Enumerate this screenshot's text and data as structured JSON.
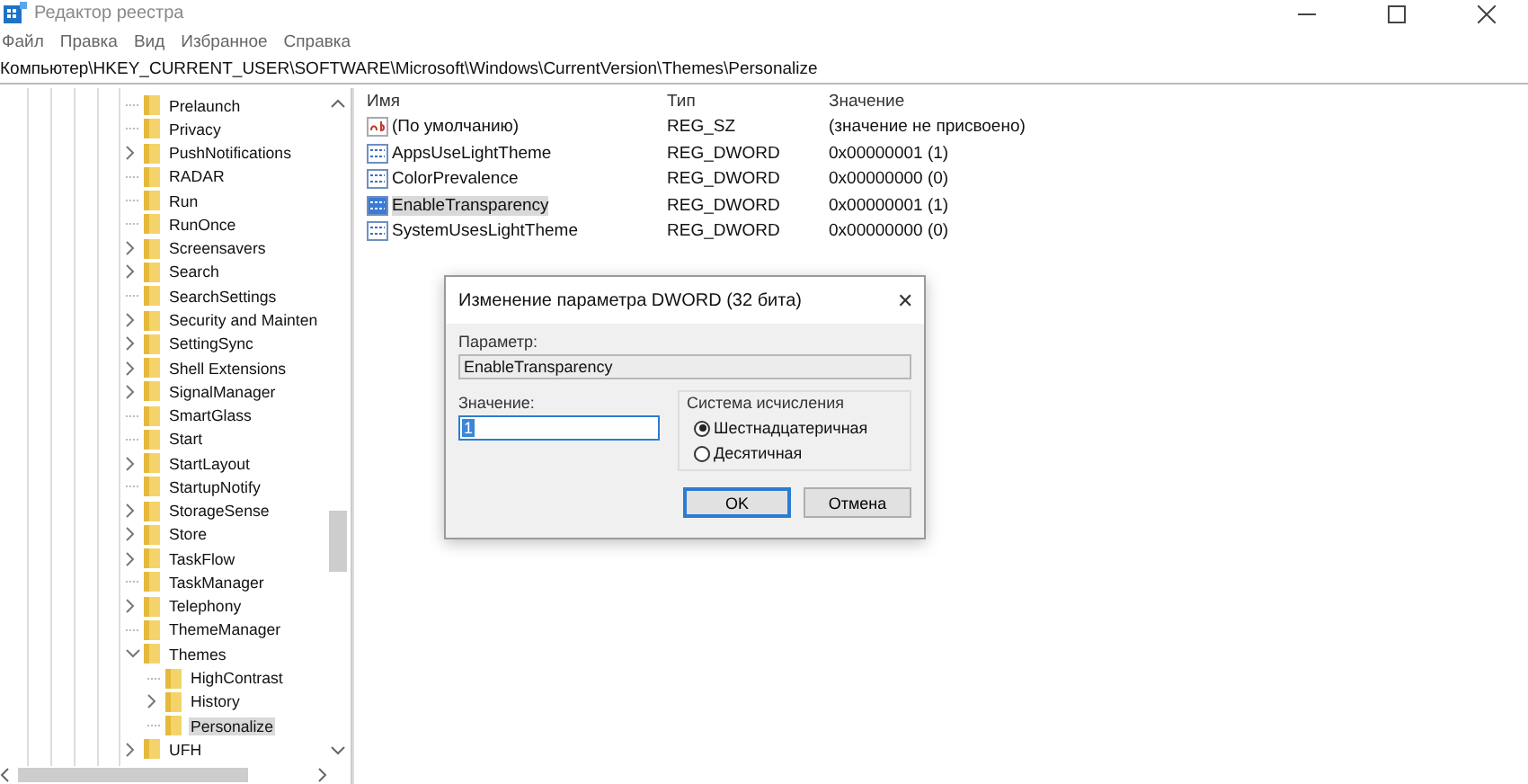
{
  "window": {
    "title": "Редактор реестра"
  },
  "menu": [
    "Файл",
    "Правка",
    "Вид",
    "Избранное",
    "Справка"
  ],
  "address": "Компьютер\\HKEY_CURRENT_USER\\SOFTWARE\\Microsoft\\Windows\\CurrentVersion\\Themes\\Personalize",
  "tree": [
    {
      "label": "Prelaunch",
      "kind": "leaf",
      "selected": false
    },
    {
      "label": "Privacy",
      "kind": "leaf",
      "selected": false
    },
    {
      "label": "PushNotifications",
      "kind": "collapsed",
      "selected": false
    },
    {
      "label": "RADAR",
      "kind": "leaf",
      "selected": false
    },
    {
      "label": "Run",
      "kind": "leaf",
      "selected": false
    },
    {
      "label": "RunOnce",
      "kind": "leaf",
      "selected": false
    },
    {
      "label": "Screensavers",
      "kind": "collapsed",
      "selected": false
    },
    {
      "label": "Search",
      "kind": "collapsed",
      "selected": false
    },
    {
      "label": "SearchSettings",
      "kind": "leaf",
      "selected": false
    },
    {
      "label": "Security and Mainten",
      "kind": "collapsed",
      "selected": false
    },
    {
      "label": "SettingSync",
      "kind": "collapsed",
      "selected": false
    },
    {
      "label": "Shell Extensions",
      "kind": "collapsed",
      "selected": false
    },
    {
      "label": "SignalManager",
      "kind": "collapsed",
      "selected": false
    },
    {
      "label": "SmartGlass",
      "kind": "leaf",
      "selected": false
    },
    {
      "label": "Start",
      "kind": "leaf",
      "selected": false
    },
    {
      "label": "StartLayout",
      "kind": "collapsed",
      "selected": false
    },
    {
      "label": "StartupNotify",
      "kind": "leaf",
      "selected": false
    },
    {
      "label": "StorageSense",
      "kind": "collapsed",
      "selected": false
    },
    {
      "label": "Store",
      "kind": "collapsed",
      "selected": false
    },
    {
      "label": "TaskFlow",
      "kind": "collapsed",
      "selected": false
    },
    {
      "label": "TaskManager",
      "kind": "leaf",
      "selected": false
    },
    {
      "label": "Telephony",
      "kind": "collapsed",
      "selected": false
    },
    {
      "label": "ThemeManager",
      "kind": "leaf",
      "selected": false
    },
    {
      "label": "Themes",
      "kind": "expanded",
      "selected": false,
      "children": [
        {
          "label": "HighContrast",
          "kind": "leaf",
          "selected": false
        },
        {
          "label": "History",
          "kind": "collapsed",
          "selected": false
        },
        {
          "label": "Personalize",
          "kind": "leaf",
          "selected": true
        }
      ]
    },
    {
      "label": "UFH",
      "kind": "collapsed",
      "selected": false
    }
  ],
  "list": {
    "columns": [
      "Имя",
      "Тип",
      "Значение"
    ],
    "rows": [
      {
        "kind": "string",
        "name": "(По умолчанию)",
        "type": "REG_SZ",
        "value": "(значение не присвоено)",
        "selected": false
      },
      {
        "kind": "binary",
        "name": "AppsUseLightTheme",
        "type": "REG_DWORD",
        "value": "0x00000001 (1)",
        "selected": false
      },
      {
        "kind": "binary",
        "name": "ColorPrevalence",
        "type": "REG_DWORD",
        "value": "0x00000000 (0)",
        "selected": false
      },
      {
        "kind": "binary",
        "name": "EnableTransparency",
        "type": "REG_DWORD",
        "value": "0x00000001 (1)",
        "selected": true
      },
      {
        "kind": "binary",
        "name": "SystemUsesLightTheme",
        "type": "REG_DWORD",
        "value": "0x00000000 (0)",
        "selected": false
      }
    ]
  },
  "dialog": {
    "title": "Изменение параметра DWORD (32 бита)",
    "close": "✕",
    "param_label": "Параметр:",
    "param_value": "EnableTransparency",
    "value_label": "Значение:",
    "value": "1",
    "base_group": "Система исчисления",
    "bases": [
      {
        "label": "Шестнадцатеричная",
        "selected": true
      },
      {
        "label": "Десятичная",
        "selected": false
      }
    ],
    "buttons": [
      {
        "label": "OK",
        "default": true
      },
      {
        "label": "Отмена",
        "default": false
      }
    ]
  }
}
